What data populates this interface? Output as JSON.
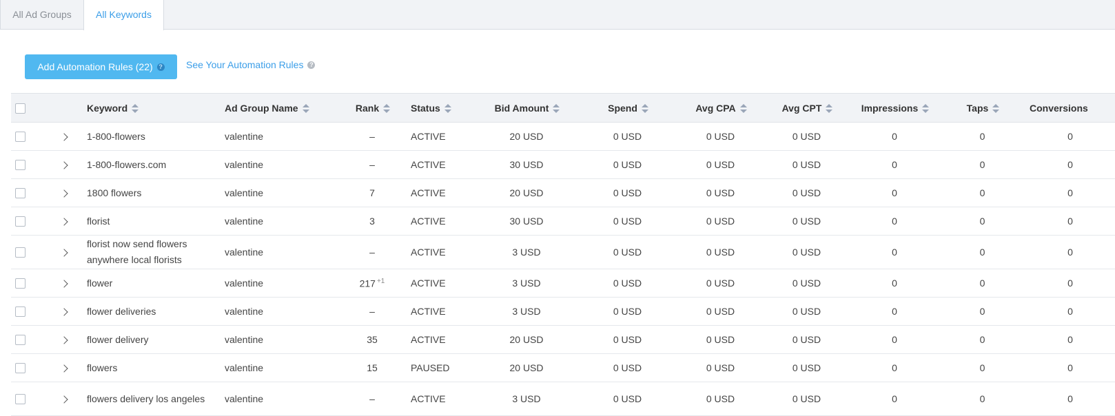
{
  "tabs": [
    {
      "label": "All Ad Groups",
      "active": false
    },
    {
      "label": "All Keywords",
      "active": true
    }
  ],
  "toolbar": {
    "add_rules_label": "Add Automation Rules (22)",
    "see_rules_label": "See Your Automation Rules"
  },
  "table": {
    "columns": [
      "Keyword",
      "Ad Group Name",
      "Rank",
      "Status",
      "Bid Amount",
      "Spend",
      "Avg CPA",
      "Avg CPT",
      "Impressions",
      "Taps",
      "Conversions"
    ],
    "rows": [
      {
        "keyword": "1-800-flowers",
        "ad_group": "valentine",
        "rank": "–",
        "status": "ACTIVE",
        "bid": "20 USD",
        "spend": "0 USD",
        "cpa": "0 USD",
        "cpt": "0 USD",
        "impressions": "0",
        "taps": "0",
        "conversions": "0"
      },
      {
        "keyword": "1-800-flowers.com",
        "ad_group": "valentine",
        "rank": "–",
        "status": "ACTIVE",
        "bid": "30 USD",
        "spend": "0 USD",
        "cpa": "0 USD",
        "cpt": "0 USD",
        "impressions": "0",
        "taps": "0",
        "conversions": "0"
      },
      {
        "keyword": "1800 flowers",
        "ad_group": "valentine",
        "rank": "7",
        "status": "ACTIVE",
        "bid": "20 USD",
        "spend": "0 USD",
        "cpa": "0 USD",
        "cpt": "0 USD",
        "impressions": "0",
        "taps": "0",
        "conversions": "0"
      },
      {
        "keyword": "florist",
        "ad_group": "valentine",
        "rank": "3",
        "status": "ACTIVE",
        "bid": "30 USD",
        "spend": "0 USD",
        "cpa": "0 USD",
        "cpt": "0 USD",
        "impressions": "0",
        "taps": "0",
        "conversions": "0"
      },
      {
        "keyword": "florist now send flowers anywhere local florists",
        "ad_group": "valentine",
        "rank": "–",
        "status": "ACTIVE",
        "bid": "3 USD",
        "spend": "0 USD",
        "cpa": "0 USD",
        "cpt": "0 USD",
        "impressions": "0",
        "taps": "0",
        "conversions": "0"
      },
      {
        "keyword": "flower",
        "ad_group": "valentine",
        "rank": "217",
        "rank_change": "+1",
        "status": "ACTIVE",
        "bid": "3 USD",
        "spend": "0 USD",
        "cpa": "0 USD",
        "cpt": "0 USD",
        "impressions": "0",
        "taps": "0",
        "conversions": "0"
      },
      {
        "keyword": "flower deliveries",
        "ad_group": "valentine",
        "rank": "–",
        "status": "ACTIVE",
        "bid": "3 USD",
        "spend": "0 USD",
        "cpa": "0 USD",
        "cpt": "0 USD",
        "impressions": "0",
        "taps": "0",
        "conversions": "0"
      },
      {
        "keyword": "flower delivery",
        "ad_group": "valentine",
        "rank": "35",
        "status": "ACTIVE",
        "bid": "20 USD",
        "spend": "0 USD",
        "cpa": "0 USD",
        "cpt": "0 USD",
        "impressions": "0",
        "taps": "0",
        "conversions": "0"
      },
      {
        "keyword": "flowers",
        "ad_group": "valentine",
        "rank": "15",
        "status": "PAUSED",
        "bid": "20 USD",
        "spend": "0 USD",
        "cpa": "0 USD",
        "cpt": "0 USD",
        "impressions": "0",
        "taps": "0",
        "conversions": "0"
      },
      {
        "keyword": "flowers delivery los angeles",
        "ad_group": "valentine",
        "rank": "–",
        "status": "ACTIVE",
        "bid": "3 USD",
        "spend": "0 USD",
        "cpa": "0 USD",
        "cpt": "0 USD",
        "impressions": "0",
        "taps": "0",
        "conversions": "0"
      }
    ]
  },
  "icons": {
    "help": "question-circle-icon",
    "expand": "chevron-right-icon",
    "sort": "sort-icon"
  },
  "colors": {
    "accent": "#3b9ee8",
    "button": "#50b8f0"
  }
}
